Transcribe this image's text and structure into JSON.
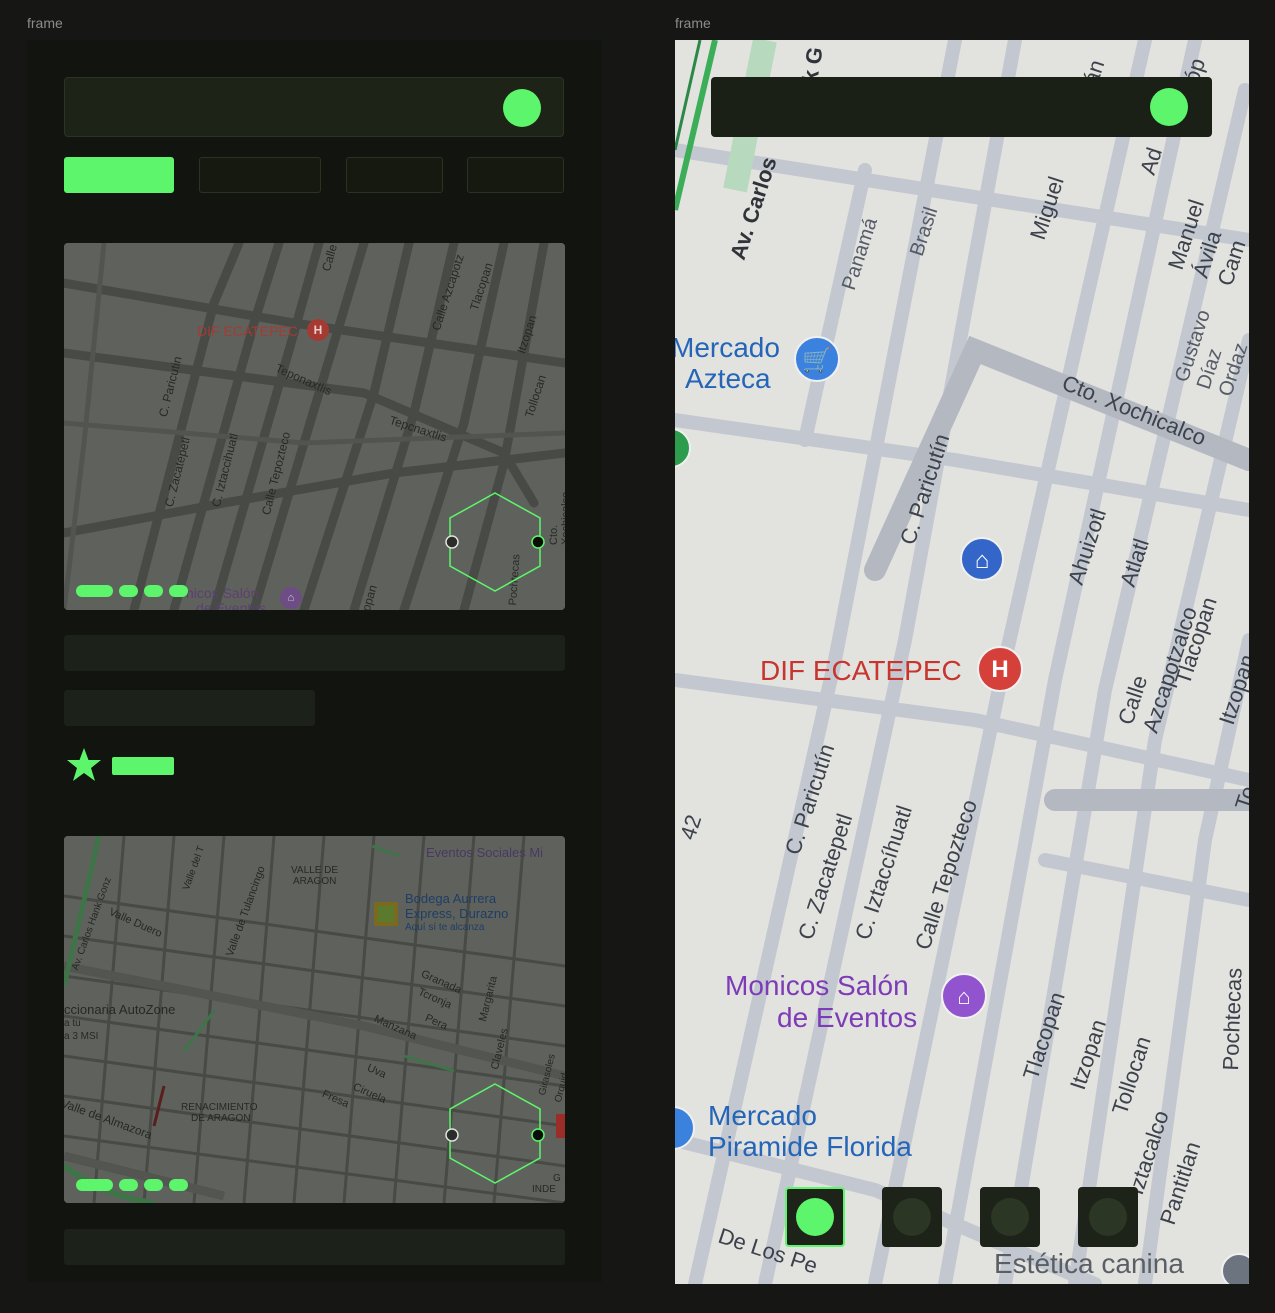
{
  "frames": [
    {
      "label": "frame"
    },
    {
      "label": "frame"
    }
  ],
  "colors": {
    "accent": "#5df56b",
    "panel": "#1d2317",
    "background": "#12140f"
  },
  "left_map_top": {
    "labels": {
      "dif": "DIF ECATEPEC",
      "teponaxtlis1": "Teponaxtlis",
      "teponaxtlis2": "Tepcnaxtlis",
      "paricutin": "C. Paricutin",
      "zacatepetl": "C. Zacatepetl",
      "iztaccihuatl": "C. Iztaccihuatl",
      "tepozteco": "Calle Tepozteco",
      "azcapotz": "Calle Azcapotz",
      "tlacopan": "Tlacopan",
      "itzopan": "Itzopan",
      "tollocan": "Tollocan",
      "xochicalco": "Cto. Xochicalco",
      "pochtecas": "Pochtecas",
      "calle": "Calle",
      "monicos": "nicos Salón",
      "eventos": "de Eventos",
      "opan": "opan"
    }
  },
  "left_map_bottom": {
    "labels": {
      "eventos_sociales": "Eventos Sociales Mi",
      "valle_aragon1": "VALLE DE",
      "valle_aragon2": "ARAGON",
      "bodega1": "Bodega Aurrera",
      "bodega2": "Express, Durazno",
      "bodega3": "Aquí sí te alcanza",
      "av_carlos": "Av. Carlos Hank Gonz",
      "valle_duero": "Valle Duero",
      "valle_tulancingo": "Valle de Tulancingo",
      "valle_del": "Valle del T",
      "autozone": "ccionaria AutoZone",
      "autozone2": "a tu",
      "autozone3": "a 3 MSI",
      "granada": "Granada",
      "toronja": "Tcronja",
      "pera": "Pera",
      "margarita": "Margarita",
      "manzana": "Manzana",
      "claveles": "Claveles",
      "uva": "Uva",
      "ciruela": "Ciruela",
      "fresa": "Fresa",
      "girasoles": "Girasoles",
      "orquid": "Orquid",
      "renacimiento1": "RENACIMIENTO",
      "renacimiento2": "DE ARAGON",
      "valle_almazora": "Valle de Almazora",
      "inde": "INDE",
      "g": "G"
    }
  },
  "right_map": {
    "labels": {
      "mercado_azteca1": "Mercado",
      "mercado_azteca2": "Azteca",
      "av_carlos": "Av. Carlos",
      "panama": "Panamá",
      "brasil": "Brasil",
      "miguel": "Miguel",
      "manuel": "Manuel Ávila Cam",
      "gustavo": "Gustavo Díaz Ordaz",
      "ad": "Ad",
      "lop": "Lóp",
      "an": "án",
      "k_g": "k G",
      "xochicalco": "Cto. Xochicalco",
      "paricutin_top": "C. Paricutín",
      "ahuizotl": "Ahuizotl",
      "atlatl": "Atlatl",
      "azcapotzalco": "Calle Azcapotzalco",
      "tlacopan_top": "Tlacopan",
      "itzopan_top": "Itzopan",
      "to": "To",
      "dif": "DIF ECATEPEC",
      "paricutin": "C. Paricutín",
      "zacatepetl": "C. Zacatepetl",
      "iztaccihuatl": "C. Iztaccíhuatl",
      "tepozteco": "Calle Tepozteco",
      "n42": "42",
      "monicos1": "Monicos Salón",
      "monicos2": "de Eventos",
      "tlacopan": "Tlacopan",
      "itzopan": "Itzopan",
      "tollocan": "Tollocan",
      "iztacalco": "Iztacalco",
      "pantitlan": "Pantitlan",
      "pochtecas": "Pochtecas",
      "mercado_piramide1": "Mercado",
      "mercado_piramide2": "Piramide Florida",
      "de_los_pe": "De Los Pe",
      "estetica": "Estética canina"
    }
  }
}
